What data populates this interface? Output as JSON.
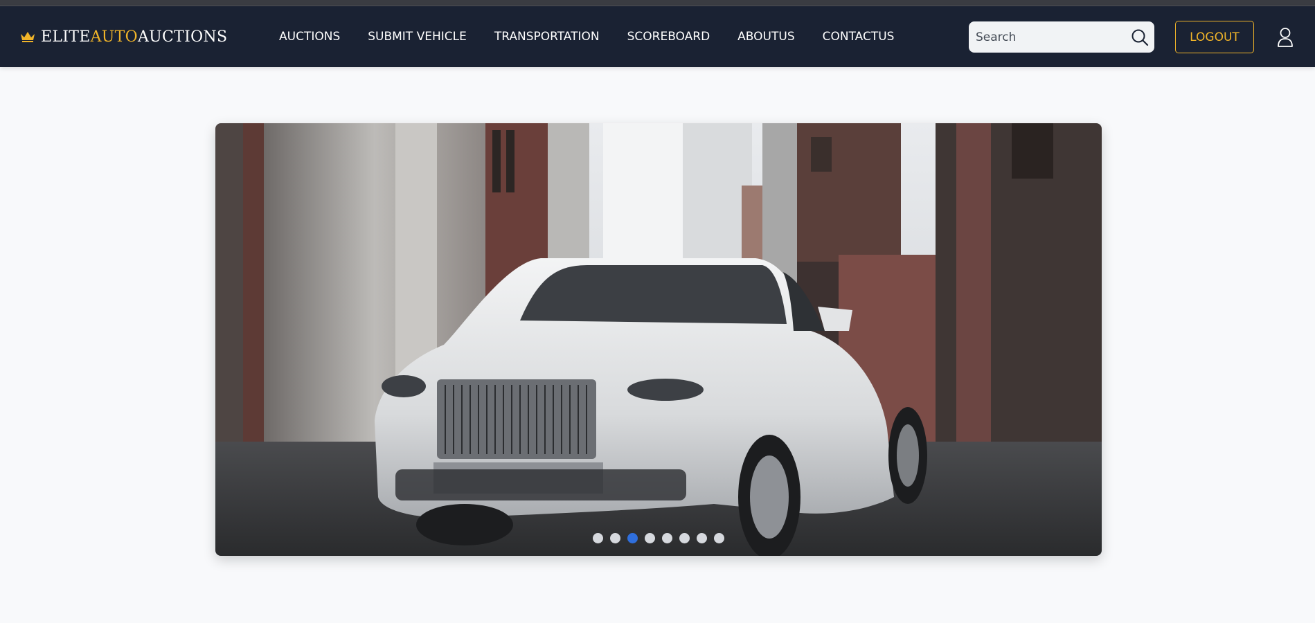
{
  "brand": {
    "part1": "ELITE",
    "part2": "AUTO",
    "part3": "AUCTIONS",
    "icon": "crown-icon"
  },
  "nav": {
    "items": [
      {
        "label": "AUCTIONS"
      },
      {
        "label": "SUBMIT VEHICLE"
      },
      {
        "label": "TRANSPORTATION"
      },
      {
        "label": "SCOREBOARD"
      },
      {
        "label": "ABOUTUS"
      },
      {
        "label": "CONTACTUS"
      }
    ]
  },
  "search": {
    "placeholder": "Search",
    "value": "",
    "icon": "search-icon"
  },
  "logout": {
    "label": "LOGOUT"
  },
  "user": {
    "icon": "user-icon"
  },
  "carousel": {
    "slide_count": 8,
    "active_index": 2,
    "image": "white luxury sedan in alley"
  },
  "colors": {
    "navbar": "#1a2233",
    "accent": "#f0b429",
    "active_dot": "#2f6fdd",
    "page_bg": "#f8f9fb"
  }
}
